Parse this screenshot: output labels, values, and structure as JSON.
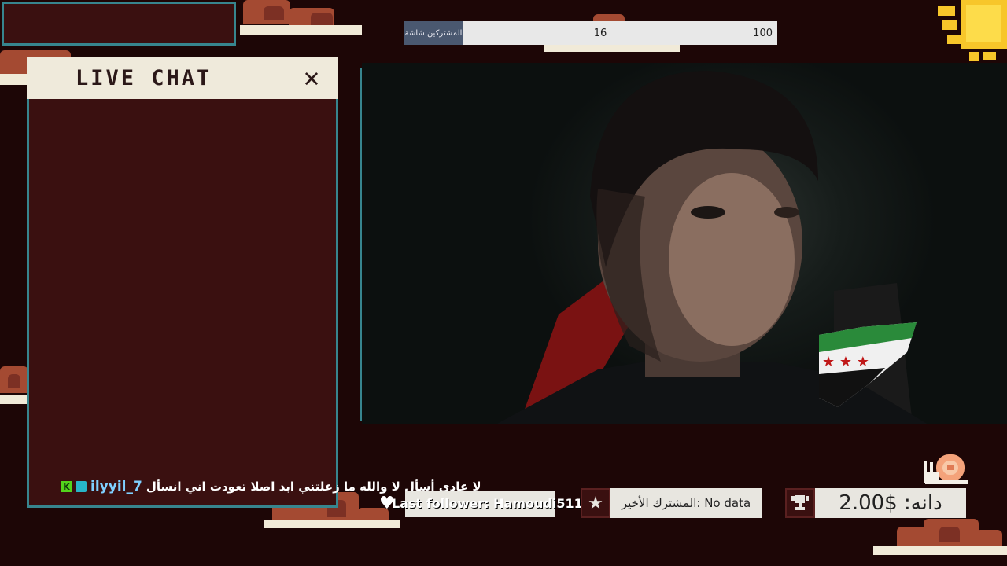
{
  "goal_bar": {
    "label": "المشتركين شاشة",
    "current": "16",
    "target": "100",
    "progress": 0.16
  },
  "chat": {
    "title": "LIVE CHAT",
    "close_glyph": "✕",
    "message": {
      "badge_letter": "K",
      "username": "ilyyil_7",
      "text": "لا عادي أسأل لا والله ما زعلتني ابد اصلا تعودت اني انسأل"
    }
  },
  "widgets": {
    "last_follower": "Last follower: Hamoudi511",
    "last_subscriber": "المشترك الأخير: No data",
    "donation": "دانه: $2.00"
  },
  "icons": {
    "heart": "heart-icon",
    "star": "star-icon",
    "trophy": "trophy-icon",
    "close": "close-icon"
  },
  "colors": {
    "background": "#1d0606",
    "panel": "#3a1010",
    "teal_border": "#37858e",
    "cream": "#efeadb",
    "cloud_red": "#a44a32"
  }
}
